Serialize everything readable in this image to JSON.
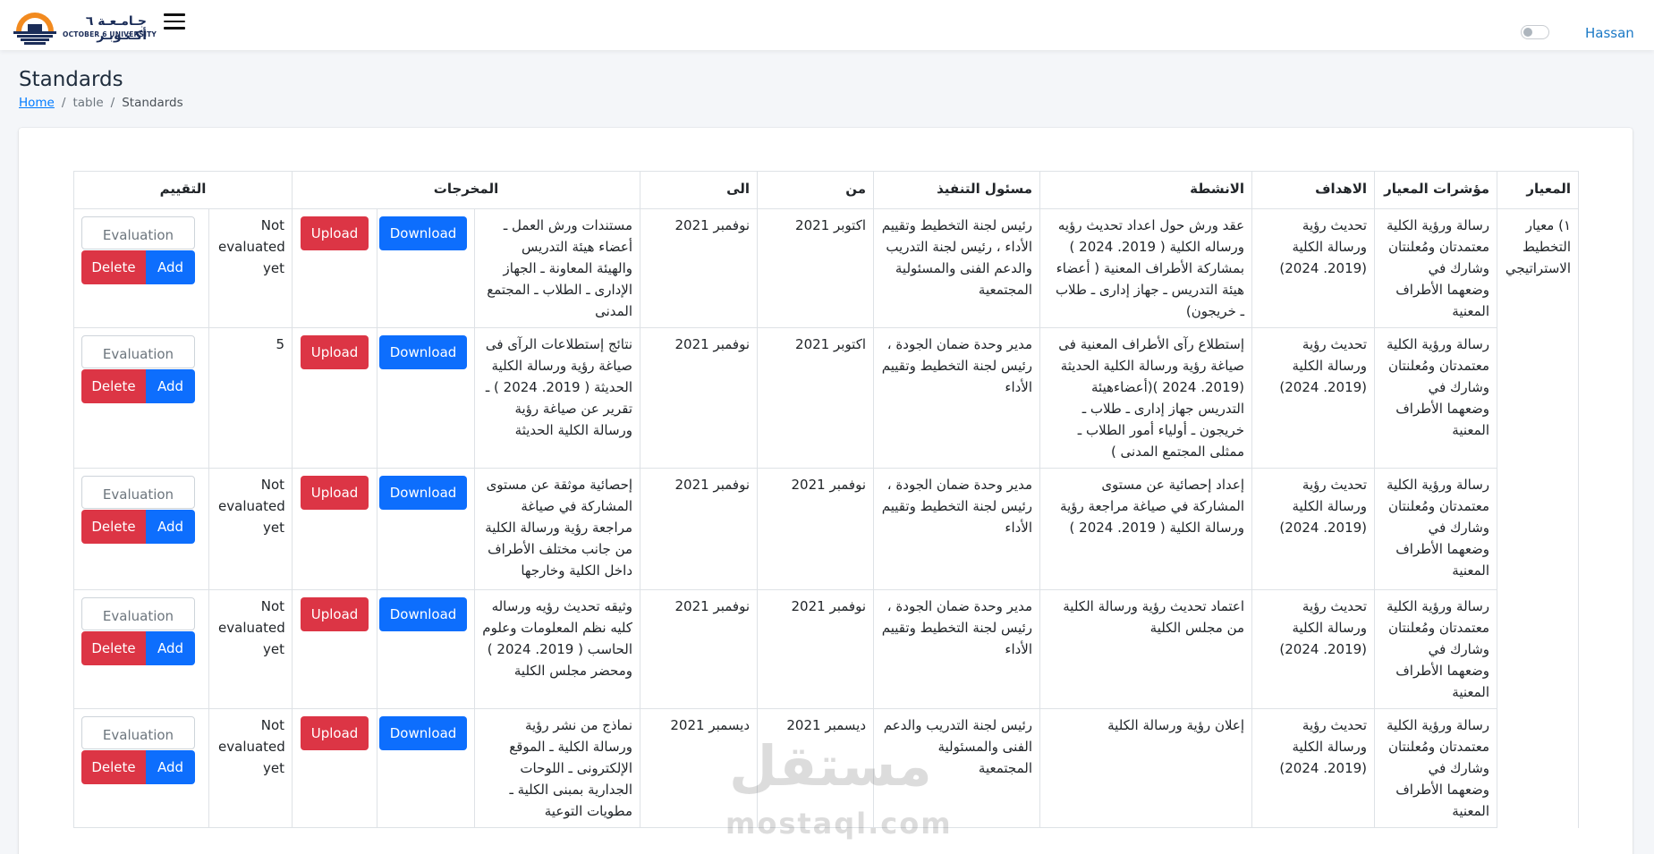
{
  "header": {
    "logo_ar": "جـامـعـة ٦ أكـتـوبـر",
    "logo_en": "OCTOBER 6 UNIVERSITY",
    "user_name": "Hassan"
  },
  "page": {
    "title": "Standards",
    "breadcrumb": [
      "Home",
      "table",
      "Standards"
    ]
  },
  "table": {
    "headers": {
      "standard": "المعيار",
      "indicators": "مؤشرات المعيار",
      "goals": "الاهداف",
      "activities": "الانشطة",
      "responsible": "مسئول التنفيذ",
      "from": "من",
      "to": "الى",
      "outputs": "المخرجات",
      "evaluation": "التقييم"
    },
    "standard_name": "١) معيار التخطيط الاستراتيجي",
    "download_label": "Download",
    "upload_label": "Upload",
    "eval_placeholder": "Evaluation",
    "add_label": "Add",
    "delete_label": "Delete",
    "rows": [
      {
        "indicator": "رسالة ورؤية الكلية معتمدتان ومُعلنتان وشارك في وضعهما الأطراف المعنية",
        "goal": "تحديث رؤية ورسالة الكلية (2019. 2024)",
        "activity": "عقد ورش حول اعداد تحديث رؤيه ورساله الكلية ( 2019. 2024 ) بمشاركة الأطراف المعنية ( أعضاء هيئة التدريس ـ جهاز إدارى ـ طلاب ـ خريجون)",
        "responsible": "رئيس لجنة التخطيط وتقييم الأداء ، رئيس لجنة التدريب والدعم الفنى والمسئولية المجتمعية",
        "from": "اكتوبر 2021",
        "to": "نوفمبر 2021",
        "output": "مستندات ورش العمل ـ أعضاء هيئة التدريس والهيئة المعاونة ـ الجهاز الإدارى ـ الطلاب ـ المجتمع المدنى",
        "status": "Not evaluated yet"
      },
      {
        "indicator": "رسالة ورؤية الكلية معتمدتان ومُعلنتان وشارك في وضعهما الأطراف المعنية",
        "goal": "تحديث رؤية ورسالة الكلية (2019. 2024)",
        "activity": "إستطلاع رآى الأطراف المعنية فى صياغة رؤية ورسالة الكلية الحديثة (2019. 2024 )(أعضاءهيئة التدريس جهاز إدارى ـ طلاب ـ خريجون ـ أولياء أمور الطلاب ـ ممثلى المجتمع المدنى )",
        "responsible": "مدير وحدة ضمان الجودة ، رئيس لجنة التخطيط وتقييم الأداء",
        "from": "اكتوبر 2021",
        "to": "نوفمبر 2021",
        "output": "نتائج إستطلاعات الرآى فى صياغة رؤية ورسالة الكلية الحديثة ( 2019. 2024 ) ـ تقرير عن صياغة رؤية ورسالة الكلية الحديثة",
        "status": "5"
      },
      {
        "indicator": "رسالة ورؤية الكلية معتمدتان ومُعلنتان وشارك في وضعهما الأطراف المعنية",
        "goal": "تحديث رؤية ورسالة الكلية (2019. 2024)",
        "activity": "إعداد إحصائية عن مستوى المشاركة في صياغة مراجعة رؤية ورسالة الكلية ( 2019. 2024 )",
        "responsible": "مدير وحدة ضمان الجودة ، رئيس لجنة التخطيط وتقييم الأداء",
        "from": "نوفمبر 2021",
        "to": "نوفمبر 2021",
        "output": "إحصائية موثقة عن مستوى المشاركة في صياغة مراجعة رؤية ورسالة الكلية من جانب مختلف الأطراف داخل الكلية وخارجها",
        "status": "Not evaluated yet"
      },
      {
        "indicator": "رسالة ورؤية الكلية معتمدتان ومُعلنتان وشارك في وضعهما الأطراف المعنية",
        "goal": "تحديث رؤية ورسالة الكلية (2019. 2024)",
        "activity": "اعتماد تحديث رؤية ورسالة الكلية من مجلس الكلية",
        "responsible": "مدير وحدة ضمان الجودة ، رئيس لجنة التخطيط وتقييم الأداء",
        "from": "نوفمبر 2021",
        "to": "نوفمبر 2021",
        "output": "وثيقه تحديث رؤيه ورساله كليه نظم المعلومات وعلوم الحاسب ( 2019. 2024 ) ومحضر مجلس الكلية",
        "status": "Not evaluated yet"
      },
      {
        "indicator": "رسالة ورؤية الكلية معتمدتان ومُعلنتان وشارك في وضعهما الأطراف المعنية",
        "goal": "تحديث رؤية ورسالة الكلية (2019. 2024)",
        "activity": "إعلان رؤية ورسالة الكلية",
        "responsible": "رئيس لجنة التدريب والدعم الفنى والمسئولية المجتمعية",
        "from": "ديسمبر 2021",
        "to": "ديسمبر 2021",
        "output": "نماذج من نشر رؤية ورسالة الكلية ـ الموقع الإلكترونى ـ اللوحات الجدارية بمبنى الكلية ـ مطويات التوعية",
        "status": "Not evaluated yet"
      }
    ]
  },
  "watermark": {
    "ar": "مستقل",
    "en": "mostaql.com"
  }
}
